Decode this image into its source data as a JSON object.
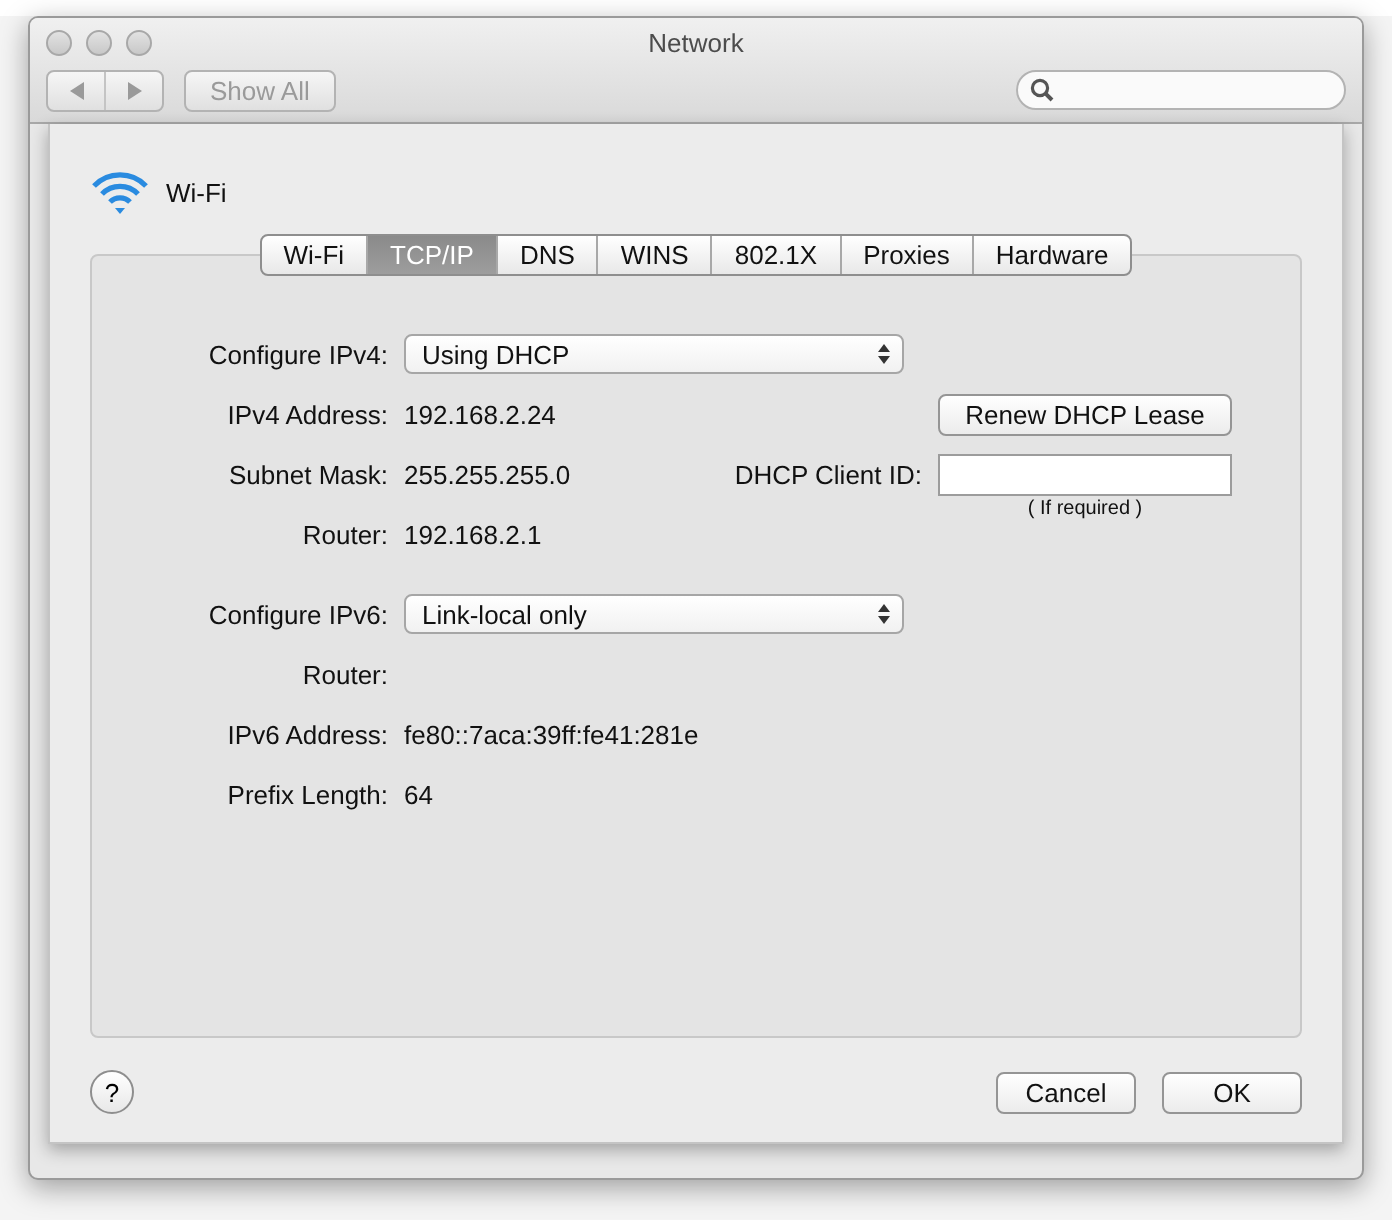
{
  "window": {
    "title": "Network"
  },
  "toolbar": {
    "show_all": {
      "label": "Show All",
      "disabled": true
    }
  },
  "sheet": {
    "title": "Wi-Fi",
    "tabs": [
      {
        "label": "Wi-Fi",
        "selected": false
      },
      {
        "label": "TCP/IP",
        "selected": true
      },
      {
        "label": "DNS",
        "selected": false
      },
      {
        "label": "WINS",
        "selected": false
      },
      {
        "label": "802.1X",
        "selected": false
      },
      {
        "label": "Proxies",
        "selected": false
      },
      {
        "label": "Hardware",
        "selected": false
      }
    ],
    "ipv4": {
      "configure": {
        "label": "Configure IPv4:",
        "value": "Using DHCP"
      },
      "fields": [
        {
          "label": "IPv4 Address:",
          "value": "192.168.2.24"
        },
        {
          "label": "Subnet Mask:",
          "value": "255.255.255.0"
        },
        {
          "label": "Router:",
          "value": "192.168.2.1"
        }
      ]
    },
    "renew_button": "Renew DHCP Lease",
    "client_id": {
      "label": "DHCP Client ID:",
      "hint": "( If required )"
    },
    "ipv6": {
      "configure": {
        "label": "Configure IPv6:",
        "value": "Link-local only"
      },
      "fields": [
        {
          "label": "Router:"
        },
        {
          "label": "IPv6 Address:",
          "value": "fe80::7aca:39ff:fe41:281e"
        },
        {
          "label": "Prefix Length:",
          "value": "64"
        }
      ]
    },
    "help": "?",
    "buttons": [
      {
        "label": "Cancel"
      },
      {
        "label": "OK"
      }
    ]
  }
}
